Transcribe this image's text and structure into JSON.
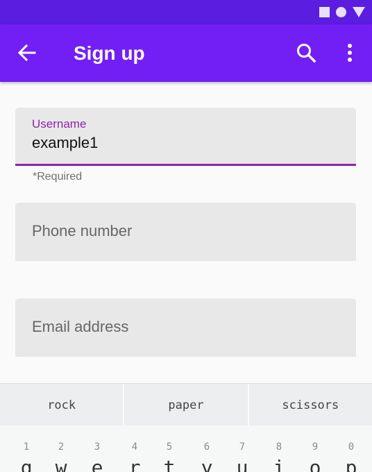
{
  "app_bar": {
    "title": "Sign up"
  },
  "form": {
    "username": {
      "label": "Username",
      "value": "example1",
      "helper": "*Required"
    },
    "phone": {
      "placeholder": "Phone number"
    },
    "email": {
      "placeholder": "Email address"
    }
  },
  "keyboard": {
    "suggestions": [
      "rock",
      "paper",
      "scissors"
    ],
    "keys": [
      {
        "num": "1",
        "letter": "q"
      },
      {
        "num": "2",
        "letter": "w"
      },
      {
        "num": "3",
        "letter": "e"
      },
      {
        "num": "4",
        "letter": "r"
      },
      {
        "num": "5",
        "letter": "t"
      },
      {
        "num": "6",
        "letter": "y"
      },
      {
        "num": "7",
        "letter": "u"
      },
      {
        "num": "8",
        "letter": "i"
      },
      {
        "num": "9",
        "letter": "o"
      },
      {
        "num": "0",
        "letter": "p"
      }
    ]
  },
  "colors": {
    "status_bar": "#5b1de0",
    "app_bar": "#721ff5",
    "accent": "#8e24aa",
    "field_bg": "#e8e8e8"
  },
  "icons": [
    "back-arrow-icon",
    "search-icon",
    "more-vert-icon",
    "square-icon",
    "circle-icon",
    "triangle-icon"
  ]
}
